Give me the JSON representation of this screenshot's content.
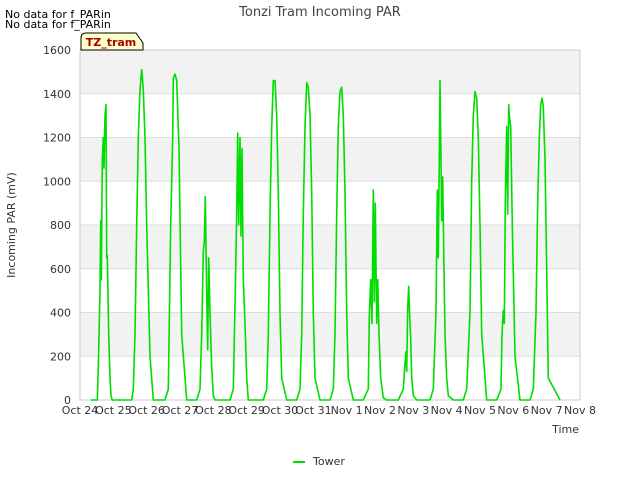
{
  "notes": [
    "No data for f_PARin",
    "No data for f_PARin"
  ],
  "site_tag": "TZ_tram",
  "chart_data": {
    "type": "line",
    "title": "Tonzi Tram Incoming PAR",
    "xlabel": "Time",
    "ylabel": "Incoming PAR (mV)",
    "xlim": [
      0,
      15
    ],
    "ylim": [
      0,
      1600
    ],
    "x_ticks": [
      "Oct 24",
      "Oct 25",
      "Oct 26",
      "Oct 27",
      "Oct 28",
      "Oct 29",
      "Oct 30",
      "Oct 31",
      "Nov 1",
      "Nov 2",
      "Nov 3",
      "Nov 4",
      "Nov 5",
      "Nov 6",
      "Nov 7",
      "Nov 8"
    ],
    "y_ticks": [
      0,
      200,
      400,
      600,
      800,
      1000,
      1200,
      1400,
      1600
    ],
    "grid": true,
    "legend_position": "bottom-center",
    "series": [
      {
        "name": "Tower",
        "color": "#00dd00",
        "x": [
          0.33,
          0.52,
          0.55,
          0.6,
          0.62,
          0.64,
          0.67,
          0.7,
          0.72,
          0.75,
          0.78,
          0.8,
          0.82,
          0.86,
          0.9,
          0.93,
          0.97,
          1.0,
          1.02,
          1.1,
          1.55,
          1.6,
          1.65,
          1.7,
          1.75,
          1.8,
          1.85,
          1.9,
          1.95,
          2.0,
          2.1,
          2.2,
          2.55,
          2.65,
          2.72,
          2.78,
          2.8,
          2.85,
          2.9,
          2.97,
          3.05,
          3.2,
          3.5,
          3.6,
          3.65,
          3.7,
          3.73,
          3.76,
          3.8,
          3.83,
          3.86,
          3.9,
          3.95,
          4.0,
          4.05,
          4.2,
          4.5,
          4.6,
          4.67,
          4.7,
          4.73,
          4.76,
          4.8,
          4.83,
          4.86,
          4.9,
          4.95,
          5.0,
          5.05,
          5.2,
          5.5,
          5.6,
          5.65,
          5.7,
          5.75,
          5.8,
          5.85,
          5.9,
          5.95,
          6.0,
          6.05,
          6.2,
          6.5,
          6.6,
          6.65,
          6.7,
          6.75,
          6.8,
          6.85,
          6.9,
          6.95,
          7.0,
          7.05,
          7.2,
          7.5,
          7.6,
          7.65,
          7.7,
          7.75,
          7.8,
          7.85,
          7.9,
          7.95,
          8.0,
          8.05,
          8.2,
          8.5,
          8.65,
          8.68,
          8.72,
          8.76,
          8.8,
          8.83,
          8.86,
          8.9,
          8.93,
          8.97,
          9.02,
          9.1,
          9.2,
          9.55,
          9.7,
          9.74,
          9.78,
          9.8,
          9.83,
          9.86,
          9.89,
          9.92,
          9.95,
          10.0,
          10.1,
          10.5,
          10.6,
          10.68,
          10.72,
          10.75,
          10.78,
          10.8,
          10.83,
          10.85,
          10.88,
          10.92,
          10.95,
          11.0,
          11.05,
          11.2,
          11.5,
          11.6,
          11.7,
          11.75,
          11.8,
          11.85,
          11.9,
          11.95,
          12.0,
          12.05,
          12.2,
          12.5,
          12.63,
          12.66,
          12.7,
          12.73,
          12.76,
          12.8,
          12.83,
          12.86,
          12.88,
          12.92,
          12.97,
          13.05,
          13.2,
          13.5,
          13.6,
          13.68,
          13.73,
          13.78,
          13.82,
          13.86,
          13.9,
          13.95,
          14.0,
          14.05,
          14.4
        ],
        "y": [
          0,
          0,
          150,
          500,
          820,
          550,
          1100,
          1200,
          1060,
          1300,
          1350,
          650,
          660,
          300,
          100,
          20,
          0,
          0,
          0,
          0,
          0,
          50,
          300,
          800,
          1200,
          1420,
          1510,
          1420,
          1200,
          800,
          200,
          0,
          0,
          50,
          800,
          1200,
          1470,
          1490,
          1460,
          1150,
          300,
          0,
          0,
          50,
          300,
          680,
          720,
          930,
          480,
          230,
          650,
          400,
          150,
          20,
          0,
          0,
          0,
          50,
          600,
          850,
          1220,
          800,
          1200,
          750,
          1150,
          550,
          350,
          100,
          0,
          0,
          0,
          50,
          300,
          850,
          1250,
          1460,
          1460,
          1300,
          950,
          400,
          100,
          0,
          0,
          50,
          300,
          850,
          1250,
          1450,
          1430,
          1300,
          950,
          400,
          100,
          0,
          0,
          50,
          300,
          850,
          1250,
          1410,
          1430,
          1300,
          950,
          400,
          100,
          0,
          0,
          50,
          380,
          550,
          350,
          960,
          450,
          900,
          350,
          550,
          300,
          100,
          10,
          0,
          0,
          50,
          150,
          220,
          130,
          420,
          520,
          380,
          280,
          100,
          20,
          0,
          0,
          50,
          400,
          960,
          650,
          1100,
          1460,
          1100,
          820,
          1020,
          600,
          300,
          100,
          20,
          0,
          0,
          50,
          400,
          1000,
          1300,
          1410,
          1380,
          1200,
          800,
          300,
          0,
          0,
          50,
          300,
          410,
          350,
          900,
          1250,
          850,
          1350,
          1300,
          1250,
          800,
          200,
          0,
          0,
          50,
          400,
          900,
          1200,
          1350,
          1380,
          1340,
          1100,
          600,
          100,
          0
        ]
      }
    ]
  }
}
